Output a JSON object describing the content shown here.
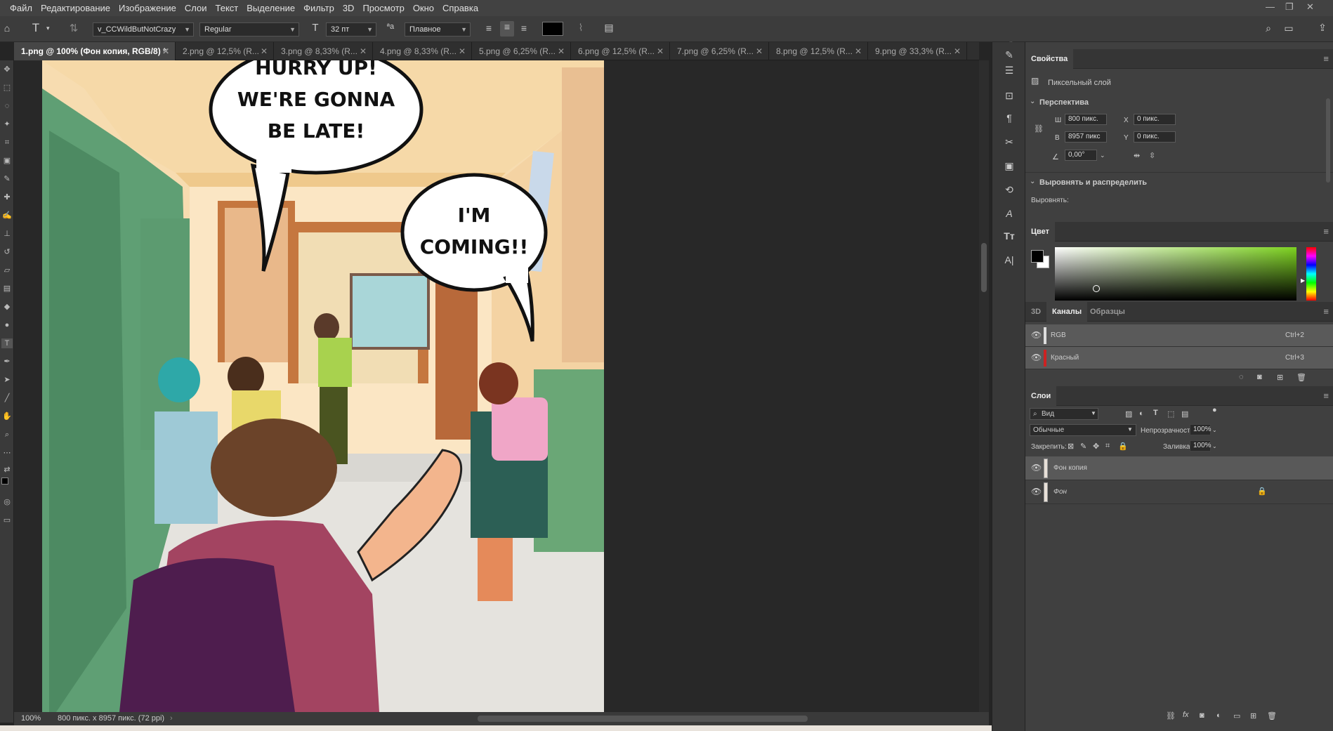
{
  "menu": [
    "Файл",
    "Редактирование",
    "Изображение",
    "Слои",
    "Текст",
    "Выделение",
    "Фильтр",
    "3D",
    "Просмотр",
    "Окно",
    "Справка"
  ],
  "options": {
    "font_family": "v_CCWildButNotCrazy",
    "font_style": "Regular",
    "font_size": "32 пт",
    "antialias": "Плавное",
    "text_color": "#000000"
  },
  "tabs": [
    {
      "label": "1.png @ 100% (Фон копия, RGB/8) *",
      "active": true
    },
    {
      "label": "2.png @ 12,5% (R...",
      "active": false
    },
    {
      "label": "3.png @ 8,33% (R...",
      "active": false
    },
    {
      "label": "4.png @ 8,33% (R...",
      "active": false
    },
    {
      "label": "5.png @ 6,25% (R...",
      "active": false
    },
    {
      "label": "6.png @ 12,5% (R...",
      "active": false
    },
    {
      "label": "7.png @ 6,25% (R...",
      "active": false
    },
    {
      "label": "8.png @ 12,5% (R...",
      "active": false
    },
    {
      "label": "9.png @ 33,3% (R...",
      "active": false
    }
  ],
  "artwork": {
    "bubble1_lines": [
      "HURRY UP!",
      "WE'RE GONNA",
      "BE LATE!"
    ],
    "bubble2_lines": [
      "I'M",
      "COMING!!"
    ]
  },
  "status": {
    "zoom": "100%",
    "doc_size": "800 пикс. x 8957 пикс. (72 ppi)"
  },
  "properties": {
    "title": "Свойства",
    "layer_type": "Пиксельный слой",
    "perspective_title": "Перспектива",
    "w_label": "Ш",
    "w_value": "800 пикс.",
    "h_label": "В",
    "h_value": "8957 пикс",
    "x_label": "X",
    "x_value": "0 пикс.",
    "y_label": "Y",
    "y_value": "0 пикс.",
    "angle_value": "0,00°",
    "align_title": "Выровнять и распределить",
    "align_label": "Выровнять:"
  },
  "color_panel": {
    "title": "Цвет",
    "foreground": "#000000",
    "background": "#ffffff",
    "hue_color": "#7ed321"
  },
  "channels": {
    "tabs": [
      "3D",
      "Каналы",
      "Образцы"
    ],
    "active_tab": "Каналы",
    "rows": [
      {
        "name": "RGB",
        "shortcut": "Ctrl+2"
      },
      {
        "name": "Красный",
        "shortcut": "Ctrl+3"
      }
    ]
  },
  "layers": {
    "title": "Слои",
    "filter_kind": "Вид",
    "blend_mode": "Обычные",
    "opacity_label": "Непрозрачность:",
    "opacity_value": "100%",
    "lock_label": "Закрепить:",
    "fill_label": "Заливка:",
    "fill_value": "100%",
    "items": [
      {
        "name": "Фон копия",
        "selected": true,
        "locked": false
      },
      {
        "name": "Фон",
        "selected": false,
        "locked": true
      }
    ]
  }
}
